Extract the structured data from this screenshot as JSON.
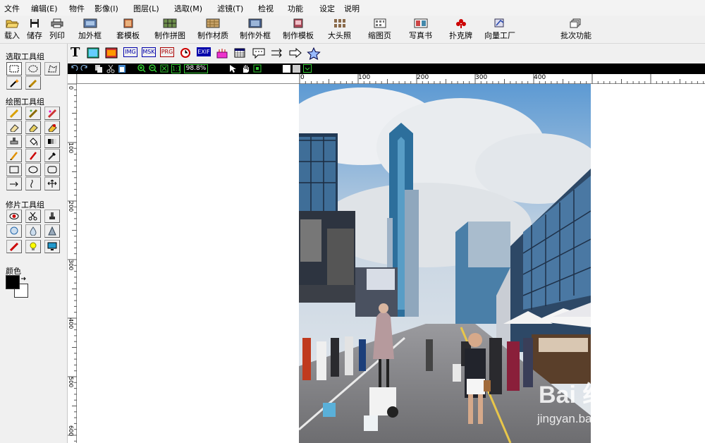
{
  "menu": [
    "文件",
    "编辑(E)",
    "物件",
    "影像(I)",
    "图层(L)",
    "选取(M)",
    "滤镜(T)",
    "检视",
    "功能",
    "设定",
    "说明"
  ],
  "toolbar": {
    "load": "载入",
    "save": "储存",
    "print": "列印",
    "items": [
      "加外框",
      "套模板",
      "制作拼图",
      "制作材质",
      "制作外框",
      "制作模板",
      "大头照",
      "缩图页",
      "写真书",
      "扑克牌",
      "向量工厂",
      "批次功能"
    ]
  },
  "left_panel": {
    "select_group": "选取工具组",
    "draw_group": "绘图工具组",
    "retouch_group": "修片工具组",
    "color_label": "颜色",
    "foreground_color": "#000000",
    "background_color": "#ffffff"
  },
  "tb2_labels": [
    "T",
    "IMG",
    "MSK",
    "PRG",
    "EXIF"
  ],
  "zoom": "98.8%",
  "hruler_labels": [
    "0",
    "100",
    "200",
    "300",
    "400"
  ],
  "vruler_labels": [
    "0",
    "100",
    "200",
    "300",
    "400",
    "500",
    "600"
  ],
  "watermark": {
    "line1": "Bai 经验",
    "line2": "jingyan.baidu.com"
  },
  "colors": {
    "sky": "#7faed9",
    "cloud": "#dfe4ea",
    "road": "#7c7c80"
  }
}
